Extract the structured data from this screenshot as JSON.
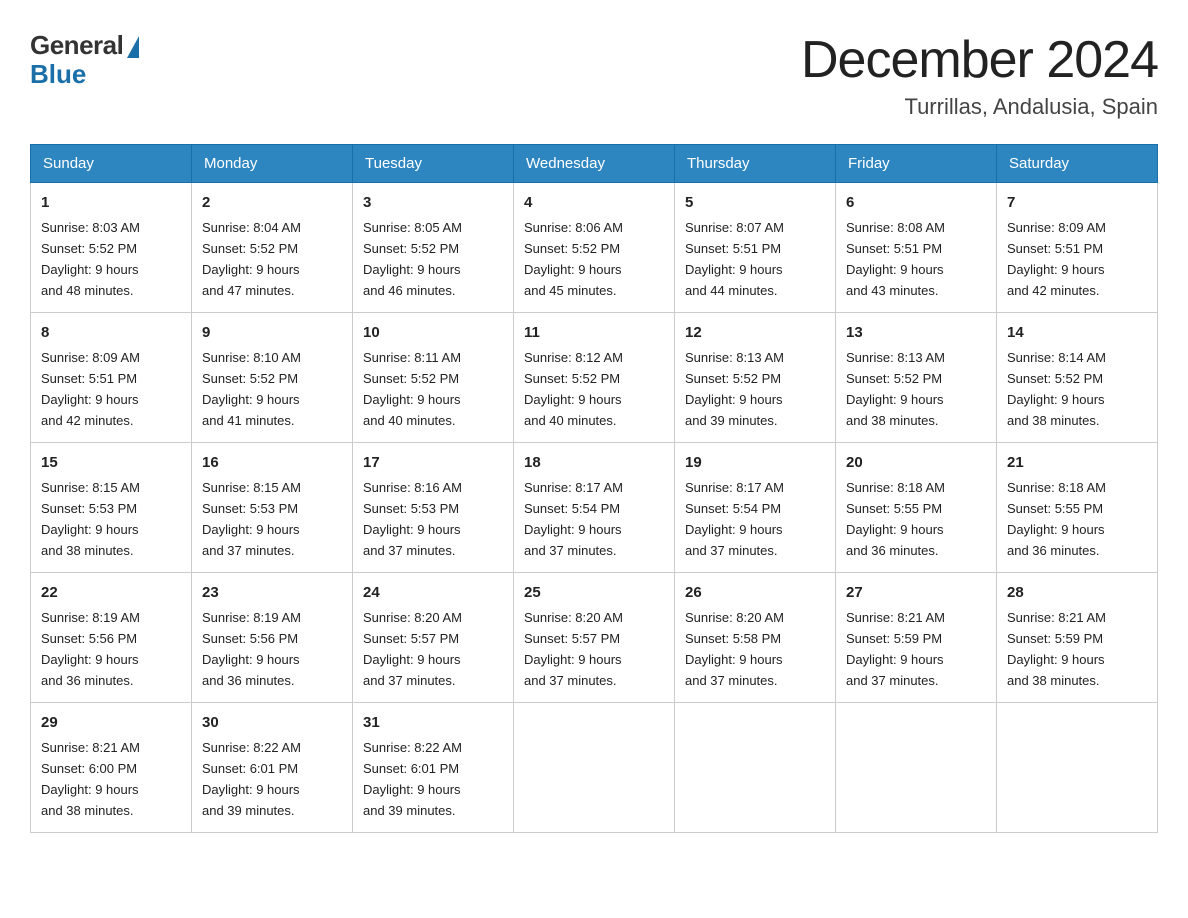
{
  "header": {
    "logo": {
      "general": "General",
      "blue": "Blue"
    },
    "title": "December 2024",
    "location": "Turrillas, Andalusia, Spain"
  },
  "columns": [
    "Sunday",
    "Monday",
    "Tuesday",
    "Wednesday",
    "Thursday",
    "Friday",
    "Saturday"
  ],
  "weeks": [
    [
      {
        "day": "1",
        "sunrise": "8:03 AM",
        "sunset": "5:52 PM",
        "daylight": "9 hours and 48 minutes."
      },
      {
        "day": "2",
        "sunrise": "8:04 AM",
        "sunset": "5:52 PM",
        "daylight": "9 hours and 47 minutes."
      },
      {
        "day": "3",
        "sunrise": "8:05 AM",
        "sunset": "5:52 PM",
        "daylight": "9 hours and 46 minutes."
      },
      {
        "day": "4",
        "sunrise": "8:06 AM",
        "sunset": "5:52 PM",
        "daylight": "9 hours and 45 minutes."
      },
      {
        "day": "5",
        "sunrise": "8:07 AM",
        "sunset": "5:51 PM",
        "daylight": "9 hours and 44 minutes."
      },
      {
        "day": "6",
        "sunrise": "8:08 AM",
        "sunset": "5:51 PM",
        "daylight": "9 hours and 43 minutes."
      },
      {
        "day": "7",
        "sunrise": "8:09 AM",
        "sunset": "5:51 PM",
        "daylight": "9 hours and 42 minutes."
      }
    ],
    [
      {
        "day": "8",
        "sunrise": "8:09 AM",
        "sunset": "5:51 PM",
        "daylight": "9 hours and 42 minutes."
      },
      {
        "day": "9",
        "sunrise": "8:10 AM",
        "sunset": "5:52 PM",
        "daylight": "9 hours and 41 minutes."
      },
      {
        "day": "10",
        "sunrise": "8:11 AM",
        "sunset": "5:52 PM",
        "daylight": "9 hours and 40 minutes."
      },
      {
        "day": "11",
        "sunrise": "8:12 AM",
        "sunset": "5:52 PM",
        "daylight": "9 hours and 40 minutes."
      },
      {
        "day": "12",
        "sunrise": "8:13 AM",
        "sunset": "5:52 PM",
        "daylight": "9 hours and 39 minutes."
      },
      {
        "day": "13",
        "sunrise": "8:13 AM",
        "sunset": "5:52 PM",
        "daylight": "9 hours and 38 minutes."
      },
      {
        "day": "14",
        "sunrise": "8:14 AM",
        "sunset": "5:52 PM",
        "daylight": "9 hours and 38 minutes."
      }
    ],
    [
      {
        "day": "15",
        "sunrise": "8:15 AM",
        "sunset": "5:53 PM",
        "daylight": "9 hours and 38 minutes."
      },
      {
        "day": "16",
        "sunrise": "8:15 AM",
        "sunset": "5:53 PM",
        "daylight": "9 hours and 37 minutes."
      },
      {
        "day": "17",
        "sunrise": "8:16 AM",
        "sunset": "5:53 PM",
        "daylight": "9 hours and 37 minutes."
      },
      {
        "day": "18",
        "sunrise": "8:17 AM",
        "sunset": "5:54 PM",
        "daylight": "9 hours and 37 minutes."
      },
      {
        "day": "19",
        "sunrise": "8:17 AM",
        "sunset": "5:54 PM",
        "daylight": "9 hours and 37 minutes."
      },
      {
        "day": "20",
        "sunrise": "8:18 AM",
        "sunset": "5:55 PM",
        "daylight": "9 hours and 36 minutes."
      },
      {
        "day": "21",
        "sunrise": "8:18 AM",
        "sunset": "5:55 PM",
        "daylight": "9 hours and 36 minutes."
      }
    ],
    [
      {
        "day": "22",
        "sunrise": "8:19 AM",
        "sunset": "5:56 PM",
        "daylight": "9 hours and 36 minutes."
      },
      {
        "day": "23",
        "sunrise": "8:19 AM",
        "sunset": "5:56 PM",
        "daylight": "9 hours and 36 minutes."
      },
      {
        "day": "24",
        "sunrise": "8:20 AM",
        "sunset": "5:57 PM",
        "daylight": "9 hours and 37 minutes."
      },
      {
        "day": "25",
        "sunrise": "8:20 AM",
        "sunset": "5:57 PM",
        "daylight": "9 hours and 37 minutes."
      },
      {
        "day": "26",
        "sunrise": "8:20 AM",
        "sunset": "5:58 PM",
        "daylight": "9 hours and 37 minutes."
      },
      {
        "day": "27",
        "sunrise": "8:21 AM",
        "sunset": "5:59 PM",
        "daylight": "9 hours and 37 minutes."
      },
      {
        "day": "28",
        "sunrise": "8:21 AM",
        "sunset": "5:59 PM",
        "daylight": "9 hours and 38 minutes."
      }
    ],
    [
      {
        "day": "29",
        "sunrise": "8:21 AM",
        "sunset": "6:00 PM",
        "daylight": "9 hours and 38 minutes."
      },
      {
        "day": "30",
        "sunrise": "8:22 AM",
        "sunset": "6:01 PM",
        "daylight": "9 hours and 39 minutes."
      },
      {
        "day": "31",
        "sunrise": "8:22 AM",
        "sunset": "6:01 PM",
        "daylight": "9 hours and 39 minutes."
      },
      null,
      null,
      null,
      null
    ]
  ]
}
